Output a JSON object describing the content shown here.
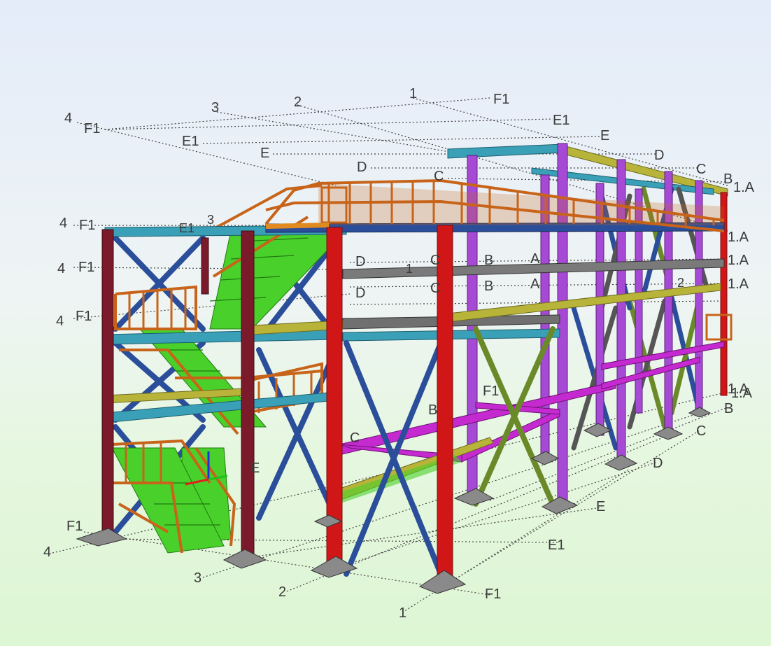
{
  "viewer": {
    "view": "3D model view",
    "colors": {
      "background_top": "#e4ecfa",
      "background_bottom": "#ddf6d3",
      "column_red": "#d01616",
      "column_maroon": "#7a1a2a",
      "column_purple": "#a64ad6",
      "bracing_blue": "#2a4e9a",
      "beam_teal": "#3aa0b8",
      "beam_olive": "#b8b43a",
      "beam_magenta": "#c42ad0",
      "beam_grey": "#707070",
      "bracing_green": "#6a8a2a",
      "handrail_orange": "#c8641a",
      "stair_green": "#4ad02a"
    }
  },
  "grid_labels": {
    "top": [
      "1",
      "2",
      "3",
      "4",
      "F1",
      "E1",
      "E",
      "D",
      "C",
      "B",
      "1.A"
    ],
    "top_numbers": [
      "1",
      "2",
      "3",
      "4"
    ],
    "top_letters": [
      "F1",
      "E1",
      "E",
      "D",
      "C",
      "B",
      "1.A"
    ],
    "left_tags": [
      "4",
      "F1",
      "4",
      "F1",
      "4",
      "F1",
      "4",
      "F1"
    ],
    "level_right": [
      "1.A",
      "1.A",
      "1.A",
      "1.A"
    ],
    "level_letters": [
      "D",
      "C",
      "B",
      "A",
      "E",
      "D",
      "C",
      "B",
      "A"
    ],
    "bottom_numbers": [
      "1",
      "2",
      "3",
      "4"
    ],
    "bottom_letters": [
      "F1",
      "E1",
      "E",
      "D",
      "C",
      "B",
      "1.A"
    ],
    "misc": [
      "E1",
      "3",
      "2",
      "1",
      "F1",
      "E",
      "D",
      "C",
      "B",
      "F1",
      "F1",
      "4"
    ]
  },
  "axis_triad": {
    "x_color": "#e02020",
    "y_color": "#20c020",
    "z_color": "#2030e0"
  }
}
